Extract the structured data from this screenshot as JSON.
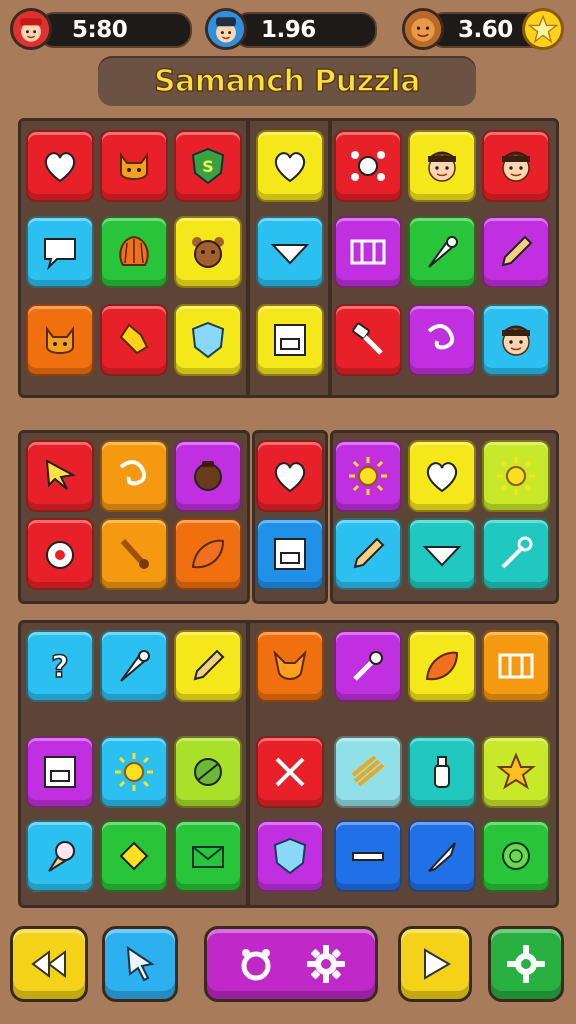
{
  "game": {
    "title": "Samanch Puzzla"
  },
  "stats": [
    {
      "icon": "red-hat-player-avatar-icon",
      "value": "5:80"
    },
    {
      "icon": "blue-hat-player-avatar-icon",
      "value": "1.96"
    },
    {
      "icon": "orange-face-avatar-icon",
      "value": "3.60",
      "badge": "star-icon"
    }
  ],
  "boards": [
    {
      "rows": [
        [
          {
            "icon": "heart-icon",
            "color": "#e8202a"
          },
          {
            "icon": "cat-face-icon",
            "color": "#e8202a"
          },
          {
            "icon": "shield-s-icon",
            "color": "#e8202a"
          },
          {
            "icon": "heart-icon",
            "color": "#f4e81a"
          },
          {
            "icon": "splat-icon",
            "color": "#e8202a"
          },
          {
            "icon": "boy-face-icon",
            "color": "#f4e81a"
          },
          {
            "icon": "boy-face-icon",
            "color": "#e8202a"
          }
        ],
        [
          {
            "icon": "speech-bubble-icon",
            "color": "#2cc0f0"
          },
          {
            "icon": "shell-icon",
            "color": "#28c43a"
          },
          {
            "icon": "bear-face-icon",
            "color": "#f4e81a"
          },
          {
            "icon": "arrowhead-icon",
            "color": "#2cc0f0"
          },
          {
            "icon": "grid-bars-icon",
            "color": "#c030e0"
          },
          {
            "icon": "cone-icon",
            "color": "#28c43a"
          },
          {
            "icon": "pencil-icon",
            "color": "#c030e0"
          }
        ],
        [
          {
            "icon": "cat-face-icon",
            "color": "#f07010"
          },
          {
            "icon": "pointing-hand-icon",
            "color": "#e8202a"
          },
          {
            "icon": "shield-icon",
            "color": "#f4e81a"
          },
          {
            "icon": "frame-icon",
            "color": "#f4e81a"
          },
          {
            "icon": "hammer-icon",
            "color": "#e8202a"
          },
          {
            "icon": "curl-icon",
            "color": "#c030e0"
          },
          {
            "icon": "boy-face-icon",
            "color": "#2cc0f0"
          }
        ]
      ]
    },
    {
      "rows": [
        [
          {
            "icon": "cursor-arrow-icon",
            "color": "#e8202a"
          },
          {
            "icon": "curl-icon",
            "color": "#f59a10"
          },
          {
            "icon": "pot-icon",
            "color": "#c030e0"
          },
          {
            "icon": "heart-icon",
            "color": "#e8202a"
          },
          {
            "icon": "sun-icon",
            "color": "#c030e0"
          },
          {
            "icon": "heart-icon",
            "color": "#f4e81a"
          },
          {
            "icon": "sun-icon",
            "color": "#c8e82a"
          }
        ],
        [
          {
            "icon": "cat-badge-icon",
            "color": "#e8202a"
          },
          {
            "icon": "brush-icon",
            "color": "#f59a10"
          },
          {
            "icon": "leaf-icon",
            "color": "#f07010"
          },
          {
            "icon": "frame-icon",
            "color": "#2090e8"
          },
          {
            "icon": "pencil-icon",
            "color": "#2cc0f0"
          },
          {
            "icon": "arrowhead-icon",
            "color": "#20c8c0"
          },
          {
            "icon": "wrench-icon",
            "color": "#20c8c0"
          }
        ]
      ]
    },
    {
      "rows": [
        [
          {
            "icon": "question-mark-icon",
            "color": "#2cc0f0"
          },
          {
            "icon": "cone-icon",
            "color": "#2cc0f0"
          },
          {
            "icon": "pencil-icon",
            "color": "#f4e81a"
          },
          {
            "icon": "fox-head-icon",
            "color": "#f07010"
          },
          {
            "icon": "torch-icon",
            "color": "#c030e0"
          },
          {
            "icon": "leaf-icon",
            "color": "#f4e81a"
          },
          {
            "icon": "grid-bars-icon",
            "color": "#f59a10"
          }
        ],
        [
          {
            "icon": "frame-icon",
            "color": "#c030e0"
          },
          {
            "icon": "sun-icon",
            "color": "#2cc0f0"
          },
          {
            "icon": "ball-icon",
            "color": "#a8e02a"
          },
          {
            "icon": "crossed-tools-icon",
            "color": "#e8202a"
          },
          {
            "icon": "stick-bundle-icon",
            "color": "#90e0e8"
          },
          {
            "icon": "bottle-icon",
            "color": "#20c8c0"
          },
          {
            "icon": "star-shape-icon",
            "color": "#c8e82a"
          }
        ],
        [
          {
            "icon": "ice-cream-icon",
            "color": "#2cc0f0"
          },
          {
            "icon": "diamond-icon",
            "color": "#28c43a"
          },
          {
            "icon": "envelope-icon",
            "color": "#28c43a"
          },
          {
            "icon": "shield-icon",
            "color": "#c030e0"
          },
          {
            "icon": "bar-icon",
            "color": "#2070e8"
          },
          {
            "icon": "knife-icon",
            "color": "#2070e8"
          },
          {
            "icon": "citrus-icon",
            "color": "#28c43a"
          }
        ]
      ]
    }
  ],
  "toolbar": [
    {
      "icon": "rewind-icon",
      "color": "#f4d21a"
    },
    {
      "icon": "cursor-icon",
      "color": "#2cb0f0"
    },
    {
      "icon": "settings-icon",
      "color": "#c028c8"
    },
    {
      "icon": "play-icon",
      "color": "#f4d21a"
    },
    {
      "icon": "gear-icon",
      "color": "#28b040"
    }
  ]
}
